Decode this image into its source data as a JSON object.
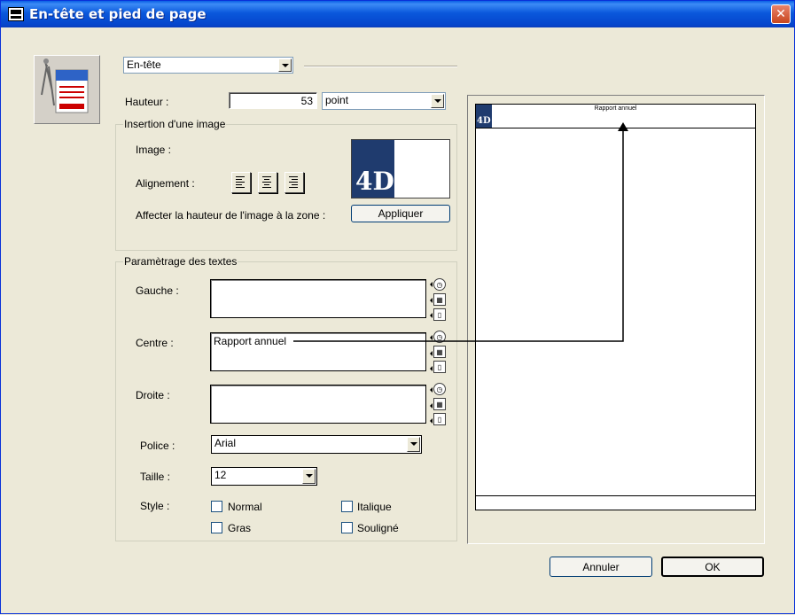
{
  "window": {
    "title": "En-tête et pied de page",
    "close_label": "✕"
  },
  "section_select": {
    "value": "En-tête"
  },
  "height": {
    "label": "Hauteur :",
    "value": "53",
    "unit": "point"
  },
  "image_group": {
    "legend": "Insertion d'une image",
    "image_label": "Image :",
    "alignment_label": "Alignement :",
    "apply_label": "Affecter la hauteur de l'image à la zone :",
    "apply_button": "Appliquer",
    "logo_text": "4D"
  },
  "text_group": {
    "legend": "Paramètrage des textes",
    "left_label": "Gauche :",
    "center_label": "Centre :",
    "right_label": "Droite :",
    "left_value": "",
    "center_value": "Rapport annuel",
    "right_value": "",
    "font_label": "Police :",
    "font_value": "Arial",
    "size_label": "Taille :",
    "size_value": "12",
    "style_label": "Style :",
    "styles": {
      "normal": "Normal",
      "italic": "Italique",
      "bold": "Gras",
      "underline": "Souligné"
    }
  },
  "preview": {
    "header_text": "Rapport annuel",
    "logo_text": "4D"
  },
  "buttons": {
    "cancel": "Annuler",
    "ok": "OK"
  }
}
